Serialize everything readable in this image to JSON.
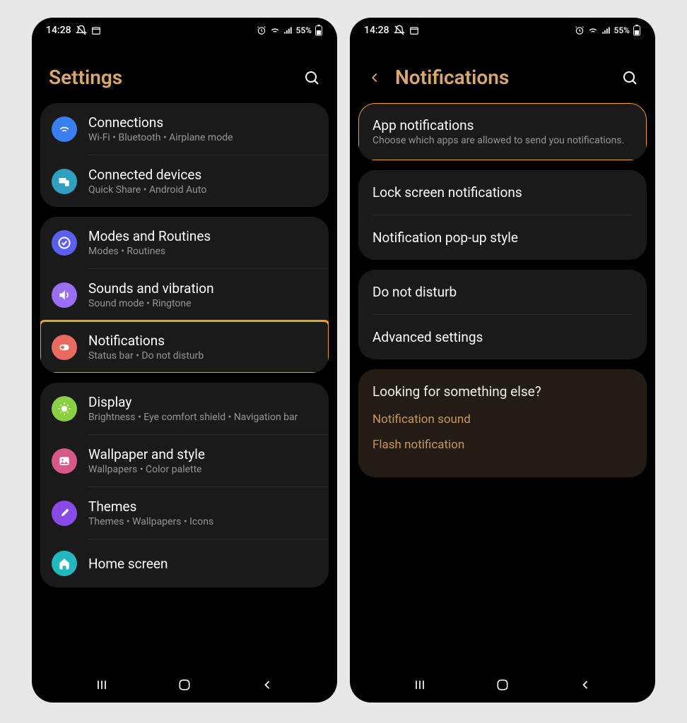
{
  "status": {
    "time": "14:28",
    "battery": "55%"
  },
  "left": {
    "title": "Settings",
    "groups": [
      {
        "items": [
          {
            "iconClass": "ic-blue",
            "icon": "wifi",
            "title": "Connections",
            "sub": "Wi-Fi  •  Bluetooth  •  Airplane mode"
          },
          {
            "iconClass": "ic-cyan",
            "icon": "devices",
            "title": "Connected devices",
            "sub": "Quick Share  •  Android Auto"
          }
        ]
      },
      {
        "items": [
          {
            "iconClass": "ic-indigo",
            "icon": "check",
            "title": "Modes and Routines",
            "sub": "Modes  •  Routines"
          },
          {
            "iconClass": "ic-violet",
            "icon": "sound",
            "title": "Sounds and vibration",
            "sub": "Sound mode  •  Ringtone"
          },
          {
            "iconClass": "ic-salmon",
            "icon": "bell",
            "title": "Notifications",
            "sub": "Status bar  •  Do not disturb",
            "highlighted": true
          }
        ]
      },
      {
        "items": [
          {
            "iconClass": "ic-lime",
            "icon": "sun",
            "title": "Display",
            "sub": "Brightness  •  Eye comfort shield  •  Navigation bar"
          },
          {
            "iconClass": "ic-pink",
            "icon": "image",
            "title": "Wallpaper and style",
            "sub": "Wallpapers  •  Color palette"
          },
          {
            "iconClass": "ic-purple",
            "icon": "brush",
            "title": "Themes",
            "sub": "Themes  •  Wallpapers  •  Icons"
          },
          {
            "iconClass": "ic-teal",
            "icon": "home",
            "title": "Home screen",
            "sub": ""
          }
        ]
      }
    ]
  },
  "right": {
    "title": "Notifications",
    "group1": [
      {
        "title": "App notifications",
        "sub": "Choose which apps are allowed to send you notifications.",
        "highlighted": true
      }
    ],
    "group2": [
      {
        "title": "Lock screen notifications"
      },
      {
        "title": "Notification pop-up style"
      }
    ],
    "group3": [
      {
        "title": "Do not disturb"
      },
      {
        "title": "Advanced settings"
      }
    ],
    "suggest": {
      "title": "Looking for something else?",
      "links": [
        "Notification sound",
        "Flash notification"
      ]
    }
  }
}
